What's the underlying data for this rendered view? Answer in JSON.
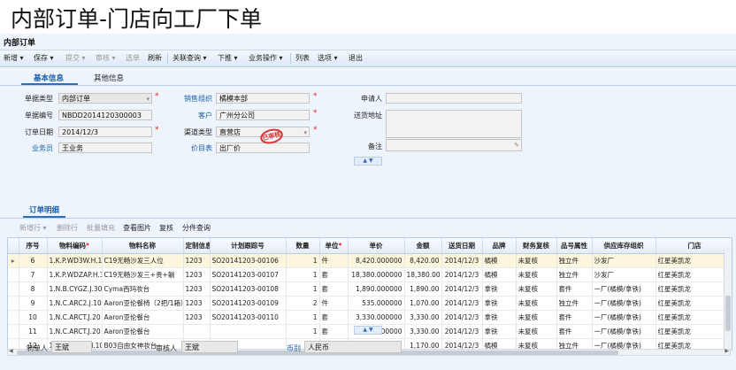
{
  "slide_title": "内部订单-门店向工厂下单",
  "window": {
    "title": "内部订单"
  },
  "toolbar": {
    "items": [
      {
        "label": "新增 ▾",
        "enabled": true
      },
      {
        "label": "保存 ▾",
        "enabled": true
      },
      {
        "label": "提交 ▾",
        "enabled": false
      },
      {
        "label": "审核 ▾",
        "enabled": false
      },
      {
        "label": "选单",
        "enabled": false
      },
      {
        "label": "刷新",
        "enabled": true
      },
      {
        "label": "关联查询 ▾",
        "enabled": true
      },
      {
        "label": "下推 ▾",
        "enabled": true
      },
      {
        "label": "业务操作 ▾",
        "enabled": true
      },
      {
        "label": "列表",
        "enabled": true
      },
      {
        "label": "选项 ▾",
        "enabled": true
      },
      {
        "label": "退出",
        "enabled": true
      }
    ]
  },
  "tabs": [
    {
      "label": "基本信息",
      "active": true
    },
    {
      "label": "其他信息",
      "active": false
    }
  ],
  "form": {
    "bill_type": {
      "label": "单据类型",
      "value": "内部订单"
    },
    "bill_no": {
      "label": "单据编号",
      "value": "NBDD2014120300003"
    },
    "order_date": {
      "label": "订单日期",
      "value": "2014/12/3"
    },
    "salesman": {
      "label": "业务员",
      "value": "王业务"
    },
    "sales_org": {
      "label": "销售组织",
      "value": "橘模本部"
    },
    "customer": {
      "label": "客户",
      "value": "广州分公司"
    },
    "channel": {
      "label": "渠道类型",
      "value": "直营店"
    },
    "price_list": {
      "label": "价目表",
      "value": "出厂价"
    },
    "applicant": {
      "label": "申请人",
      "value": ""
    },
    "ship_addr": {
      "label": "送货地址",
      "value": ""
    },
    "remark": {
      "label": "备注",
      "value": ""
    },
    "stamp": "已审核"
  },
  "detail": {
    "tab_label": "订单明细",
    "toolbar": [
      {
        "label": "新增行 ▾",
        "enabled": false
      },
      {
        "label": "删除行",
        "enabled": false
      },
      {
        "label": "批量填充",
        "enabled": false
      },
      {
        "label": "查看图片",
        "enabled": true
      },
      {
        "label": "复核",
        "enabled": true
      },
      {
        "label": "分件查询",
        "enabled": true
      }
    ],
    "columns": [
      "序号",
      "物料编码",
      "物料名称",
      "定制信息",
      "计划跟踪号",
      "数量",
      "单位",
      "单价",
      "金额",
      "送货日期",
      "品牌",
      "财务复核",
      "品号属性",
      "供应库存组织",
      "门店"
    ],
    "rows": [
      [
        "6",
        "1.K.P.WD3W.H.16",
        "C19无畅沙发三人位",
        "1203",
        "SO20141203-00106",
        "1",
        "件",
        "8,420.000000",
        "8,420.00",
        "2014/12/3",
        "橘模",
        "未复核",
        "独立件",
        "沙发厂",
        "红星美凯龙"
      ],
      [
        "7",
        "1.K.P.WDZAP.H.3",
        "C19无畅沙发三+贵+躺",
        "1203",
        "SO20141203-00107",
        "1",
        "套",
        "18,380.000000",
        "18,380.00",
        "2014/12/3",
        "橘模",
        "未复核",
        "独立件",
        "沙发厂",
        "红星美凯龙"
      ],
      [
        "8",
        "1.N.B.CYGZ.J.30",
        "Cyma西玛妆台",
        "1203",
        "SO20141203-00108",
        "1",
        "套",
        "1,890.000000",
        "1,890.00",
        "2014/12/3",
        "拿铁",
        "未复核",
        "套件",
        "一厂(橘模/拿铁)",
        "红星美凯龙"
      ],
      [
        "9",
        "1.N.C.ARC2.J.10",
        "Aaron亚伦餐椅（2把/1箱）",
        "1203",
        "SO20141203-00109",
        "2",
        "件",
        "535.000000",
        "1,070.00",
        "2014/12/3",
        "拿铁",
        "未复核",
        "独立件",
        "一厂(橘模/拿铁)",
        "红星美凯龙"
      ],
      [
        "10",
        "1.N.C.ARCT.J.20",
        "Aaron亚伦餐台",
        "1203",
        "SO20141203-00110",
        "1",
        "套",
        "3,330.000000",
        "3,330.00",
        "2014/12/3",
        "拿铁",
        "未复核",
        "套件",
        "一厂(橘模/拿铁)",
        "红星美凯龙"
      ],
      [
        "11",
        "1.N.C.ARCT.J.20",
        "Aaron亚伦餐台",
        "",
        "",
        "1",
        "套",
        "3,330.000000",
        "3,330.00",
        "2014/12/3",
        "拿铁",
        "未复核",
        "套件",
        "一厂(橘模/拿铁)",
        "红星美凯龙"
      ],
      [
        "12",
        "1.K.B.B03Z.H.10",
        "B03自由女神妆台",
        "",
        "",
        "1",
        "件",
        "1,170.000000",
        "1,170.00",
        "2014/12/3",
        "橘模",
        "未复核",
        "独立件",
        "一厂(橘模/拿铁)",
        "红星美凯龙"
      ]
    ]
  },
  "footer": {
    "creator": {
      "label": "制单人",
      "value": "王斌"
    },
    "auditor": {
      "label": "审核人",
      "value": "王斌"
    },
    "currency": {
      "label": "币别",
      "value": "人民币"
    }
  }
}
